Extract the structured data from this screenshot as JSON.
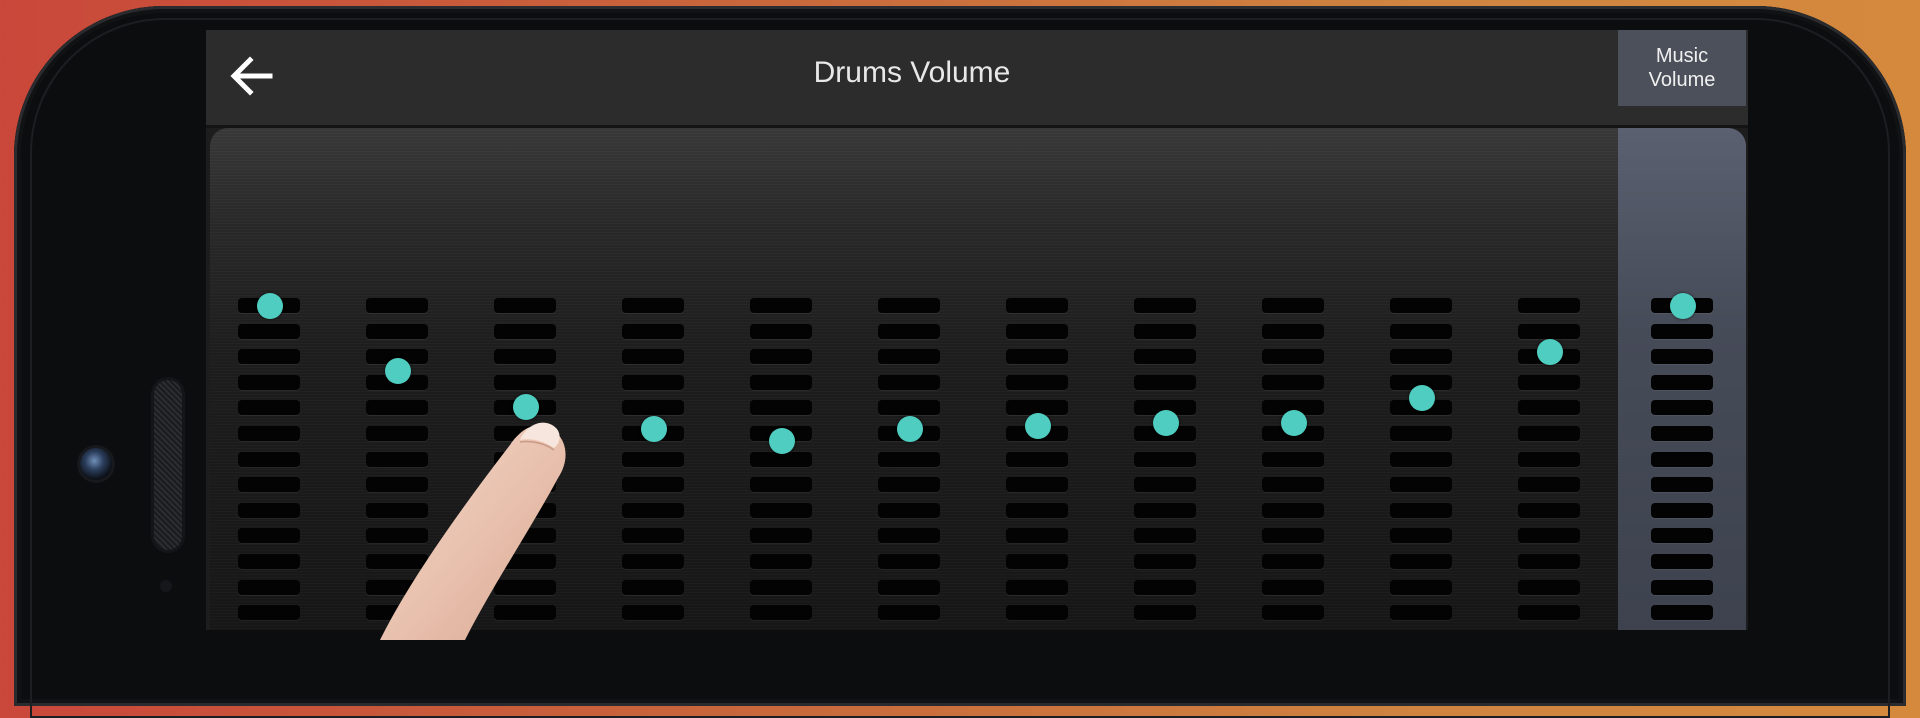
{
  "header": {
    "title": "Drums Volume",
    "music_tab_line1": "Music",
    "music_tab_line2": "Volume"
  },
  "colors": {
    "knob": "#4ecdc0",
    "topbar": "#2c2c2c",
    "music_column": "#4c505a",
    "title_text": "#e8e8e8"
  },
  "icons": {
    "back": "arrow-left-icon"
  },
  "mixer": {
    "slot_count": 13,
    "channels": [
      {
        "level": 1.0
      },
      {
        "level": 0.79
      },
      {
        "level": 0.67
      },
      {
        "level": 0.6
      },
      {
        "level": 0.56
      },
      {
        "level": 0.6
      },
      {
        "level": 0.61
      },
      {
        "level": 0.62
      },
      {
        "level": 0.62
      },
      {
        "level": 0.7
      },
      {
        "level": 0.85
      }
    ],
    "music_channel": {
      "level": 1.0
    }
  }
}
